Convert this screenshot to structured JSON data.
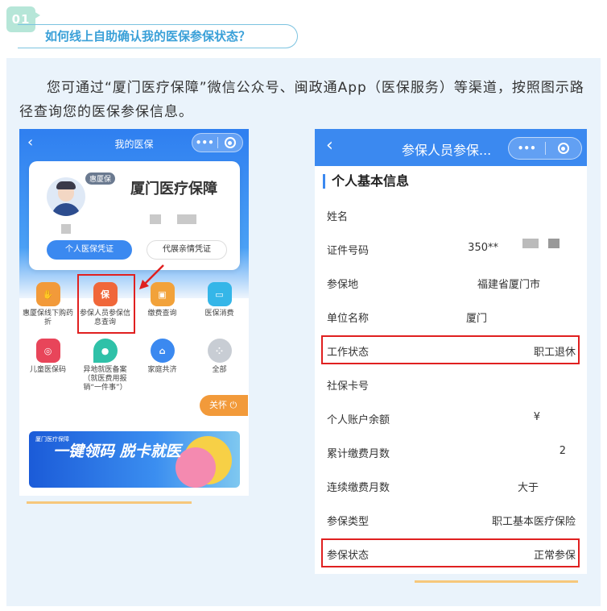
{
  "header": {
    "number": "01",
    "title": "如何线上自助确认我的医保参保状态？"
  },
  "intro": "您可通过“厦门医疗保障”微信公众号、闽政通App（医保服务）等渠道，按照图示路径查询您的医保参保信息。",
  "left_phone": {
    "nav_title": "我的医保",
    "capsule_dots": "•••",
    "badge": "惠厦保",
    "brand": "厦门医疗保障",
    "btn_personal": "个人医保凭证",
    "btn_family": "代展亲情凭证",
    "grid": [
      {
        "label": "惠厦保线下购药折",
        "icon": "hand-icon",
        "glyph": "",
        "color": "#f29a3a"
      },
      {
        "label": "参保人员参保信息查询",
        "icon": "shield-icon",
        "glyph": "保",
        "color": "#f0673a"
      },
      {
        "label": "缴费查询",
        "icon": "wallet-icon",
        "glyph": "",
        "color": "#f2a23a"
      },
      {
        "label": "医保消费",
        "icon": "card-icon",
        "glyph": "",
        "color": "#35b6e8"
      },
      {
        "label": "儿童医保码",
        "icon": "child-code-icon",
        "glyph": "",
        "color": "#e8455a"
      },
      {
        "label": "异地就医备案（就医费用报销“一件事”）",
        "icon": "location-icon",
        "glyph": "",
        "color": "#2fc1a8"
      },
      {
        "label": "家庭共济",
        "icon": "home-icon",
        "glyph": "",
        "color": "#3b89f0"
      },
      {
        "label": "全部",
        "icon": "all-icon",
        "glyph": "",
        "color": "#c8cdd4"
      }
    ],
    "care_button": "关怀 ⏻",
    "banner_small": "厦门医疗保障",
    "banner_title": "一键领码 脱卡就医"
  },
  "right_phone": {
    "nav_title": "参保人员参保...",
    "capsule_dots": "•••",
    "section_title": "个人基本信息",
    "rows": [
      {
        "k": "姓名",
        "v": ""
      },
      {
        "k": "证件号码",
        "v": "350**"
      },
      {
        "k": "参保地",
        "v": "福建省厦门市"
      },
      {
        "k": "单位名称",
        "v": "厦门"
      },
      {
        "k": "工作状态",
        "v": "职工退休"
      },
      {
        "k": "社保卡号",
        "v": ""
      },
      {
        "k": "个人账户余额",
        "v": "¥"
      },
      {
        "k": "累计缴费月数",
        "v": "2"
      },
      {
        "k": "连续缴费月数",
        "v": "大于"
      },
      {
        "k": "参保类型",
        "v": "职工基本医疗保险"
      },
      {
        "k": "参保状态",
        "v": "正常参保"
      }
    ]
  },
  "colors": {
    "accent_blue": "#3b89f0",
    "highlight_red": "#e02020",
    "panel_bg": "#eaf3fb",
    "header_teal": "#b6e6d8"
  }
}
